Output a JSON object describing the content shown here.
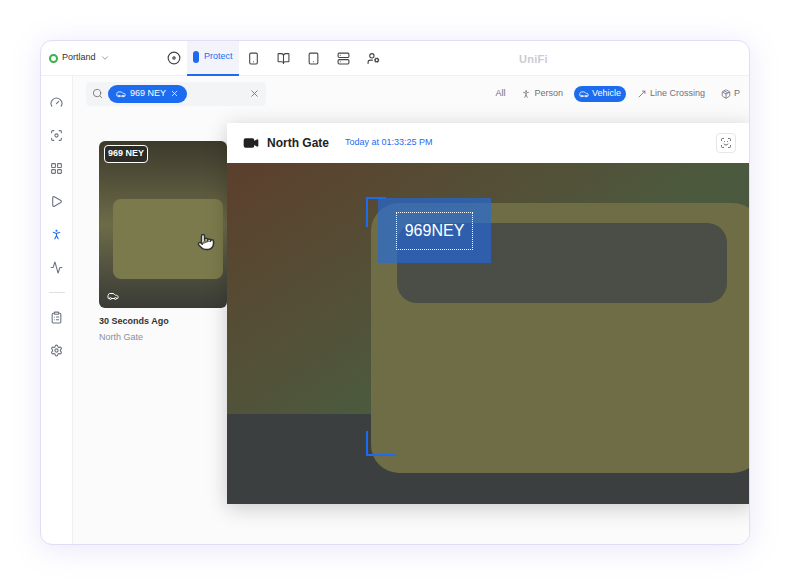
{
  "app": {
    "location": "Portland",
    "logo": "UniFi"
  },
  "app_tabs": [
    {
      "label": "Protect",
      "selected": true
    }
  ],
  "sidebar": {
    "items": [
      {
        "selected": false
      },
      {
        "selected": false
      },
      {
        "selected": false
      },
      {
        "selected": false
      },
      {
        "selected": true
      },
      {
        "selected": false
      },
      {
        "selected": false
      },
      {
        "selected": false
      }
    ]
  },
  "search": {
    "chips": [
      {
        "label": "969 NEY"
      }
    ]
  },
  "filters": [
    {
      "label": "All",
      "selected": false
    },
    {
      "label": "Person",
      "selected": false
    },
    {
      "label": "Vehicle",
      "selected": true
    },
    {
      "label": "Line Crossing",
      "selected": false
    },
    {
      "label": "P",
      "selected": false
    }
  ],
  "events": [
    {
      "plate": "969 NEY",
      "time": "30 Seconds Ago",
      "camera": "North Gate"
    }
  ],
  "detail": {
    "camera": "North Gate",
    "timestamp": "Today at 01:33:25 PM",
    "plate": "969NEY"
  }
}
